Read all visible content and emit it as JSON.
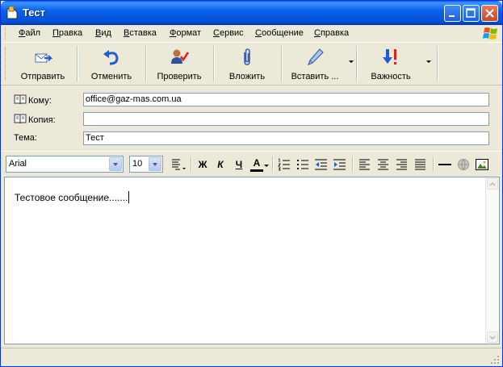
{
  "window": {
    "title": "Тест"
  },
  "menu": {
    "items": [
      "Файл",
      "Правка",
      "Вид",
      "Вставка",
      "Формат",
      "Сервис",
      "Сообщение",
      "Справка"
    ]
  },
  "toolbar": {
    "send": "Отправить",
    "undo": "Отменить",
    "check": "Проверить",
    "attach": "Вложить",
    "insert": "Вставить ...",
    "priority": "Важность"
  },
  "headers": {
    "to_label": "Кому:",
    "to_value": "office@gaz-mas.com.ua",
    "cc_label": "Копия:",
    "cc_value": "",
    "subject_label": "Тема:",
    "subject_value": "Тест"
  },
  "format": {
    "font": "Arial",
    "size": "10",
    "bold": "Ж",
    "italic": "К",
    "underline": "Ч",
    "color_letter": "A"
  },
  "body": {
    "text": "Тестовое сообщение......."
  },
  "colors": {
    "titlebar": "#0a62e8",
    "chrome": "#ece9d8",
    "accent_red": "#e02020"
  }
}
